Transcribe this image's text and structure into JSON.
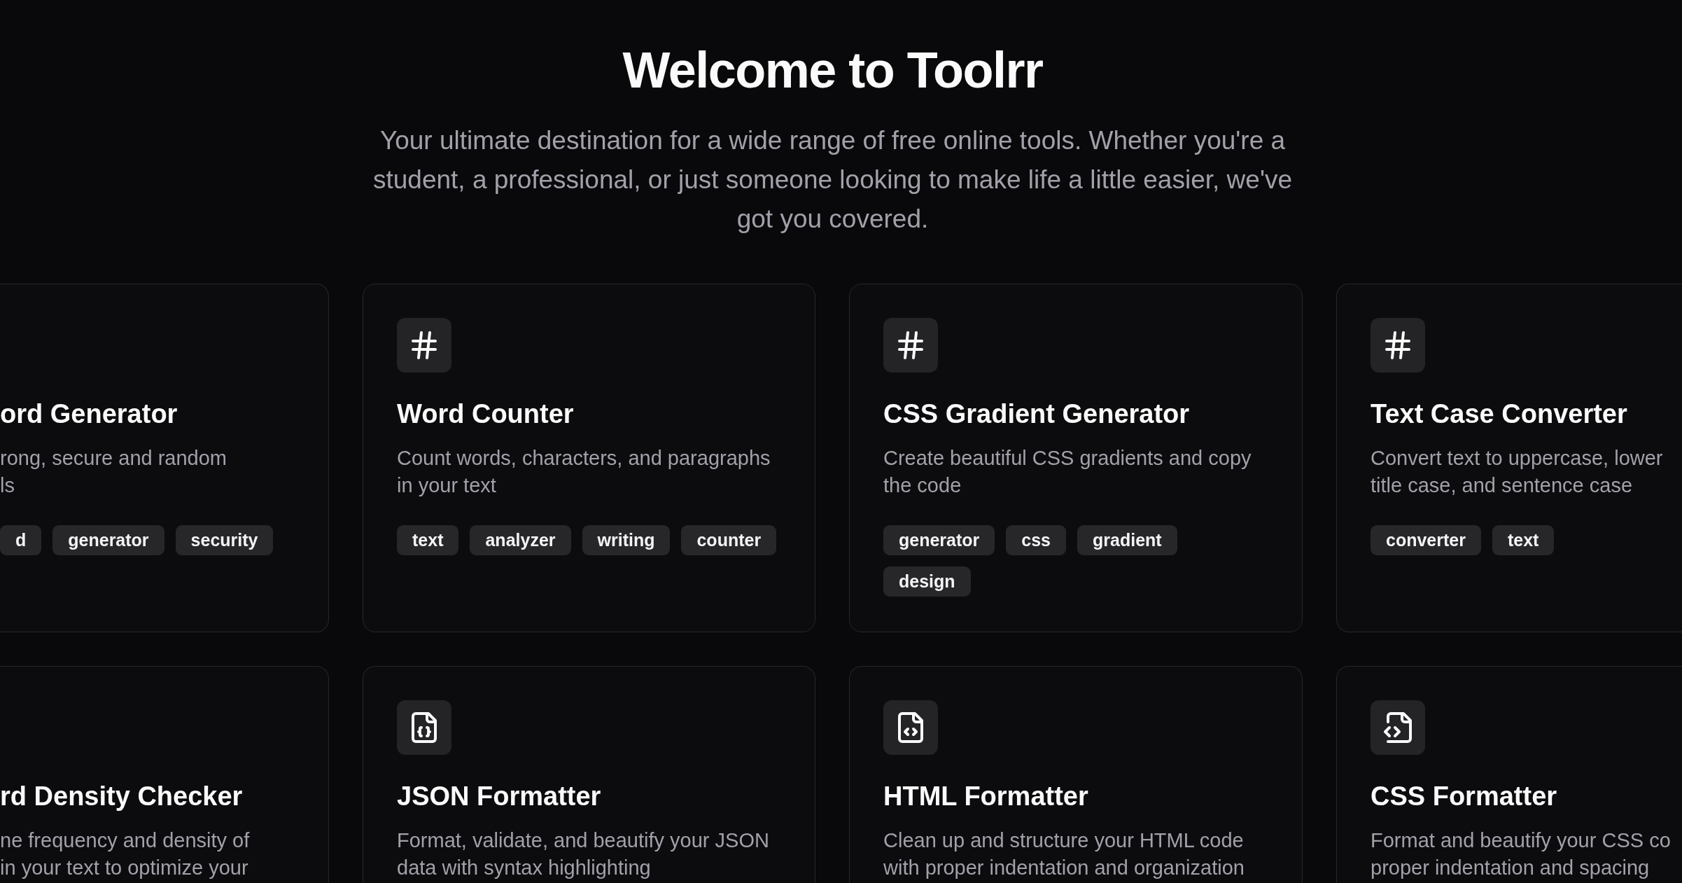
{
  "header": {
    "title": "Welcome to Toolrr",
    "subtitle": "Your ultimate destination for a wide range of free online tools. Whether you're a student, a professional, or just someone looking to make life a little easier, we've got you covered."
  },
  "tools": [
    {
      "title": "ord Generator",
      "description_lines": [
        "rong, secure and random",
        "ls"
      ],
      "tags": [
        "d",
        "generator",
        "security"
      ]
    },
    {
      "kind": "general",
      "title": "Word Counter",
      "description_lines": [
        "Count words, characters, and paragraphs",
        "in your text"
      ],
      "tags": [
        "text",
        "analyzer",
        "writing",
        "counter"
      ]
    },
    {
      "kind": "general",
      "title": "CSS Gradient Generator",
      "description_lines": [
        "Create beautiful CSS gradients and copy",
        "the code"
      ],
      "tags": [
        "generator",
        "css",
        "gradient",
        "design"
      ]
    },
    {
      "kind": "general",
      "title": "Text Case Converter",
      "description_lines": [
        "Convert text to uppercase, lower",
        "title case, and sentence case"
      ],
      "tags": [
        "converter",
        "text"
      ]
    },
    {
      "title": "rd Density Checker",
      "description_lines": [
        "ne frequency and density of",
        "in your text to optimize your"
      ]
    },
    {
      "kind": "json",
      "title": "JSON Formatter",
      "description_lines": [
        "Format, validate, and beautify your JSON",
        "data with syntax highlighting"
      ]
    },
    {
      "kind": "html",
      "title": "HTML Formatter",
      "description_lines": [
        "Clean up and structure your HTML code",
        "with proper indentation and organization"
      ]
    },
    {
      "kind": "css",
      "title": "CSS Formatter",
      "description_lines": [
        "Format and beautify your CSS co",
        "proper indentation and spacing"
      ]
    }
  ]
}
